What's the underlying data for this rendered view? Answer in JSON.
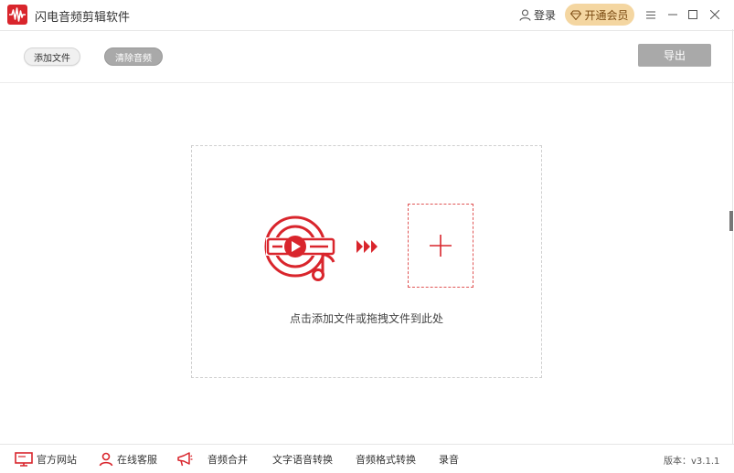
{
  "app": {
    "title": "闪电音频剪辑软件"
  },
  "header": {
    "login_label": "登录",
    "vip_label": "开通会员"
  },
  "toolbar": {
    "add_file_label": "添加文件",
    "clear_audio_label": "清除音频",
    "export_label": "导出"
  },
  "drop_zone": {
    "hint": "点击添加文件或拖拽文件到此处"
  },
  "footer": {
    "items": [
      {
        "label": "官方网站",
        "icon": "monitor-icon"
      },
      {
        "label": "在线客服",
        "icon": "person-icon"
      },
      {
        "label": "音频合并",
        "icon": "megaphone-icon"
      },
      {
        "label": "文字语音转换",
        "icon": ""
      },
      {
        "label": "音频格式转换",
        "icon": ""
      },
      {
        "label": "录音",
        "icon": ""
      }
    ],
    "version": "版本：v3.1.1"
  },
  "colors": {
    "accent": "#d9252c",
    "vip_bg": "#f4d6a1",
    "disabled_button": "#a9a9a9"
  }
}
